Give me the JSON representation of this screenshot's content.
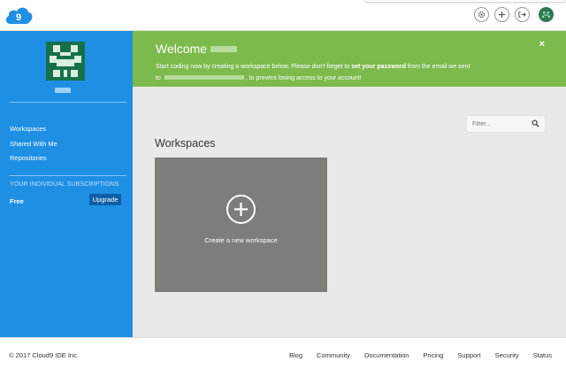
{
  "topbar": {
    "logo_icon": "cloud9-logo-icon",
    "icons": [
      "gear-icon",
      "plus-icon",
      "sign-out-icon"
    ]
  },
  "sidebar": {
    "nav": [
      "Workspaces",
      "Shared With Me",
      "Repositories"
    ],
    "subscriptions_title": "YOUR INDIVIDUAL SUBSCRIPTIONS",
    "plan": "Free",
    "upgrade_label": "Upgrade"
  },
  "banner": {
    "title": "Welcome",
    "line1_pre": "Start coding now by creating a workspace below. Please don't forget to ",
    "line1_bold": "set your password",
    "line1_post": " from the email we sent",
    "line2_pre": "to ",
    "line2_post": ", to prevent losing access to your account!",
    "close": "×"
  },
  "main": {
    "filter_placeholder": "Filter...",
    "workspaces_title": "Workspaces",
    "create_label": "Create a new workspace"
  },
  "footer": {
    "copyright": "© 2017 Cloud9 IDE Inc.",
    "links": [
      "Blog",
      "Community",
      "Documentation",
      "Pricing",
      "Support",
      "Security",
      "Status"
    ]
  },
  "colors": {
    "sidebar": "#1f8fe4",
    "banner": "#7dba4e",
    "card": "#7f7d7a",
    "upgrade": "#0f5fa6"
  }
}
